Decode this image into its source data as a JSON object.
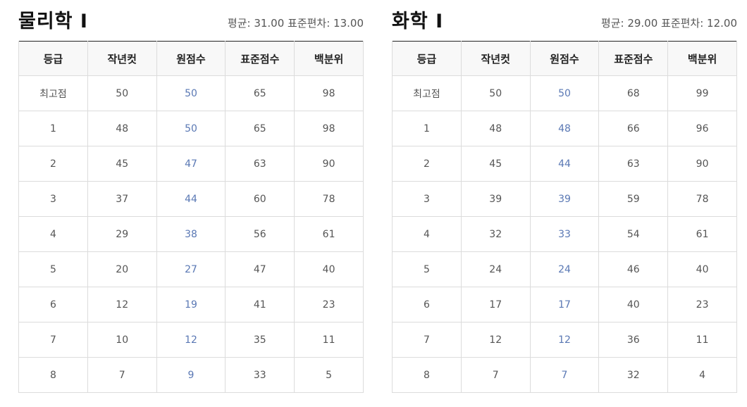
{
  "panels": [
    {
      "title": "물리학 Ⅰ",
      "stats": "평균: 31.00 표준편차: 13.00",
      "headers": [
        "등급",
        "작년컷",
        "원점수",
        "표준점수",
        "백분위"
      ],
      "rows": [
        [
          "최고점",
          "50",
          "50",
          "65",
          "98"
        ],
        [
          "1",
          "48",
          "50",
          "65",
          "98"
        ],
        [
          "2",
          "45",
          "47",
          "63",
          "90"
        ],
        [
          "3",
          "37",
          "44",
          "60",
          "78"
        ],
        [
          "4",
          "29",
          "38",
          "56",
          "61"
        ],
        [
          "5",
          "20",
          "27",
          "47",
          "40"
        ],
        [
          "6",
          "12",
          "19",
          "41",
          "23"
        ],
        [
          "7",
          "10",
          "12",
          "35",
          "11"
        ],
        [
          "8",
          "7",
          "9",
          "33",
          "5"
        ]
      ]
    },
    {
      "title": "화학 Ⅰ",
      "stats": "평균: 29.00 표준편차: 12.00",
      "headers": [
        "등급",
        "작년컷",
        "원점수",
        "표준점수",
        "백분위"
      ],
      "rows": [
        [
          "최고점",
          "50",
          "50",
          "68",
          "99"
        ],
        [
          "1",
          "48",
          "48",
          "66",
          "96"
        ],
        [
          "2",
          "45",
          "44",
          "63",
          "90"
        ],
        [
          "3",
          "39",
          "39",
          "59",
          "78"
        ],
        [
          "4",
          "32",
          "33",
          "54",
          "61"
        ],
        [
          "5",
          "24",
          "24",
          "46",
          "40"
        ],
        [
          "6",
          "17",
          "17",
          "40",
          "23"
        ],
        [
          "7",
          "12",
          "12",
          "36",
          "11"
        ],
        [
          "8",
          "7",
          "7",
          "32",
          "4"
        ]
      ]
    }
  ],
  "colors": {
    "raw_score_text": "#5a78b4",
    "header_bg": "#f8f8f8",
    "table_top_border": "#222222",
    "cell_border": "#dcdcdc"
  }
}
